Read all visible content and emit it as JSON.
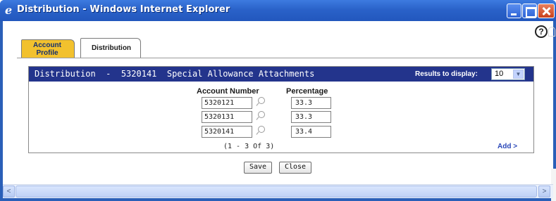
{
  "window": {
    "title": "Distribution - Windows Internet Explorer",
    "colors": {
      "titlebar": "#2a62c9",
      "panel_header": "#23348c",
      "active_tab": "#f2c12e",
      "link": "#2a47b8"
    }
  },
  "help": {
    "icon": "help-icon",
    "label": "?"
  },
  "tabs": [
    {
      "label": "Account Profile",
      "active": false
    },
    {
      "label": "Distribution",
      "active": true
    }
  ],
  "panel": {
    "title": "Distribution  -  5320141  Special Allowance Attachments",
    "results_label": "Results to display:",
    "results_value": "10"
  },
  "table": {
    "headers": {
      "account": "Account Number",
      "percentage": "Percentage"
    },
    "rows": [
      {
        "account": "5320121",
        "percentage": "33.3"
      },
      {
        "account": "5320131",
        "percentage": "33.3"
      },
      {
        "account": "5320141",
        "percentage": "33.4"
      }
    ],
    "pager": "(1 - 3 Of 3)",
    "add_link": "Add >"
  },
  "buttons": {
    "save": "Save",
    "close": "Close"
  },
  "scrollbar": {
    "left_arrow": "<",
    "right_arrow": ">"
  }
}
